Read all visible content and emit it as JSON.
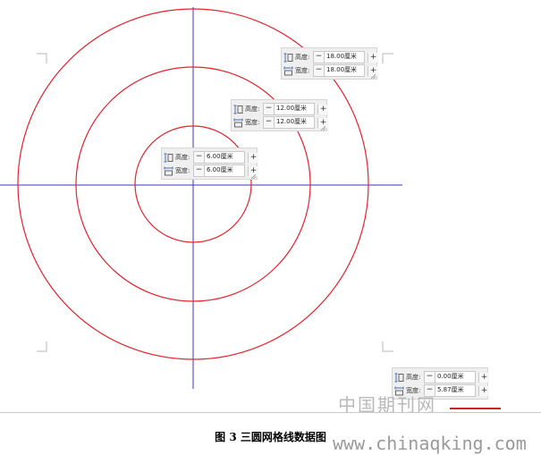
{
  "figure": {
    "caption": "图 3  三圆网格线数据图",
    "cut_text": "……"
  },
  "watermark": {
    "chinese": "中国期刊网",
    "url": "www.chinaqking.com"
  },
  "colors": {
    "circle": "#e8222e",
    "axis": "#3a34c8",
    "panel_bg": "#efefef"
  },
  "panels": [
    {
      "height": {
        "icon": "height-icon",
        "label": "高度:",
        "value": "18.00厘米"
      },
      "width": {
        "icon": "width-icon",
        "label": "宽度:",
        "value": "18.00厘米"
      }
    },
    {
      "height": {
        "icon": "height-icon",
        "label": "高度:",
        "value": "12.00厘米"
      },
      "width": {
        "icon": "width-icon",
        "label": "宽度:",
        "value": "12.00厘米"
      }
    },
    {
      "height": {
        "icon": "height-icon",
        "label": "高度:",
        "value": "6.00厘米"
      },
      "width": {
        "icon": "width-icon",
        "label": "宽度:",
        "value": "6.00厘米"
      }
    },
    {
      "height": {
        "icon": "height-icon",
        "label": "高度:",
        "value": "0.00厘米"
      },
      "width": {
        "icon": "width-icon",
        "label": "宽度:",
        "value": "5.87厘米"
      }
    }
  ],
  "buttons": {
    "minus": "−",
    "plus": "+"
  }
}
